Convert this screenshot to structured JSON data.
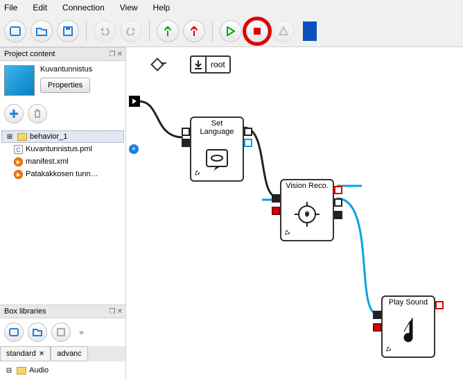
{
  "menu": {
    "file": "File",
    "edit": "Edit",
    "connection": "Connection",
    "view": "View",
    "help": "Help"
  },
  "panels": {
    "project": "Project content",
    "libs": "Box libraries"
  },
  "project": {
    "name": "Kuvantunnistus",
    "properties": "Properties"
  },
  "tree": {
    "items": [
      {
        "label": "behavior_1"
      },
      {
        "label": "Kuvantunnistus.pml"
      },
      {
        "label": "manifest.xml"
      },
      {
        "label": "Patakakkosen tunn…"
      }
    ]
  },
  "tabs": {
    "standard": "standard",
    "advanced": "advanc"
  },
  "audio_tree": {
    "root": "Audio"
  },
  "canvas": {
    "root": "root",
    "nodes": {
      "setlang": "Set Language",
      "vision": "Vision Reco.",
      "playsound": "Play Sound"
    }
  }
}
